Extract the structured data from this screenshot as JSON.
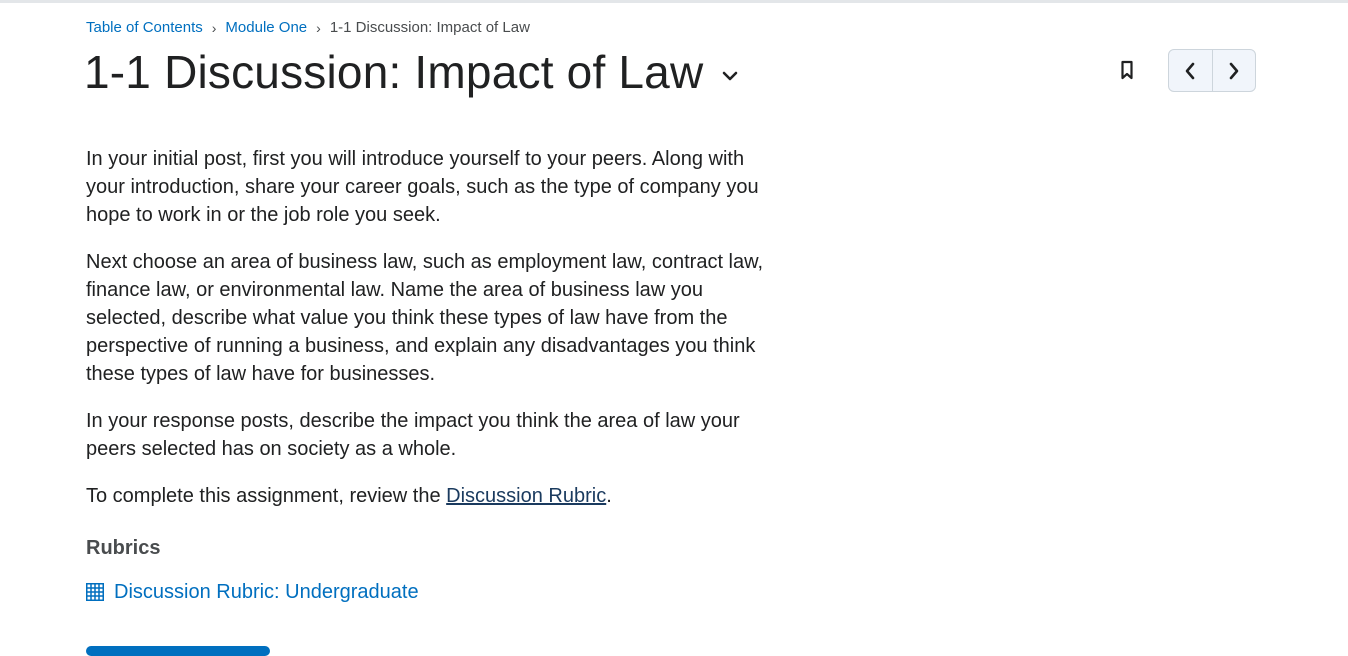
{
  "breadcrumb": {
    "items": [
      {
        "label": "Table of Contents"
      },
      {
        "label": "Module One"
      }
    ],
    "separator": "›",
    "current": "1-1 Discussion: Impact of Law"
  },
  "page": {
    "title": "1-1 Discussion: Impact of Law"
  },
  "icons": {
    "title_menu": "chevron-down-icon",
    "bookmark": "bookmark-icon",
    "previous": "chevron-left-icon",
    "next": "chevron-right-icon",
    "rubric": "grid-table-icon"
  },
  "content": {
    "paragraphs": [
      "In your initial post, first you will introduce yourself to your peers. Along with your introduction, share your career goals, such as the type of company you hope to work in or the job role you seek.",
      "Next choose an area of business law, such as employment law, contract law, finance law, or environmental law. Name the area of business law you selected, describe what value you think these types of law have from the perspective of running a business, and explain any disadvantages you think these types of law have for businesses.",
      "In your response posts, describe the impact you think the area of law your peers selected has on society as a whole."
    ],
    "assignment_prefix": "To complete this assignment, review the ",
    "assignment_link": "Discussion Rubric",
    "assignment_suffix": "."
  },
  "rubrics": {
    "heading": "Rubrics",
    "items": [
      {
        "label": "Discussion Rubric: Undergraduate"
      }
    ]
  },
  "colors": {
    "link": "#006fbf",
    "title": "#202122",
    "nav_background": "#f1f5fb",
    "nav_border": "#cdd5dc",
    "primary_button": "#006fbf"
  }
}
